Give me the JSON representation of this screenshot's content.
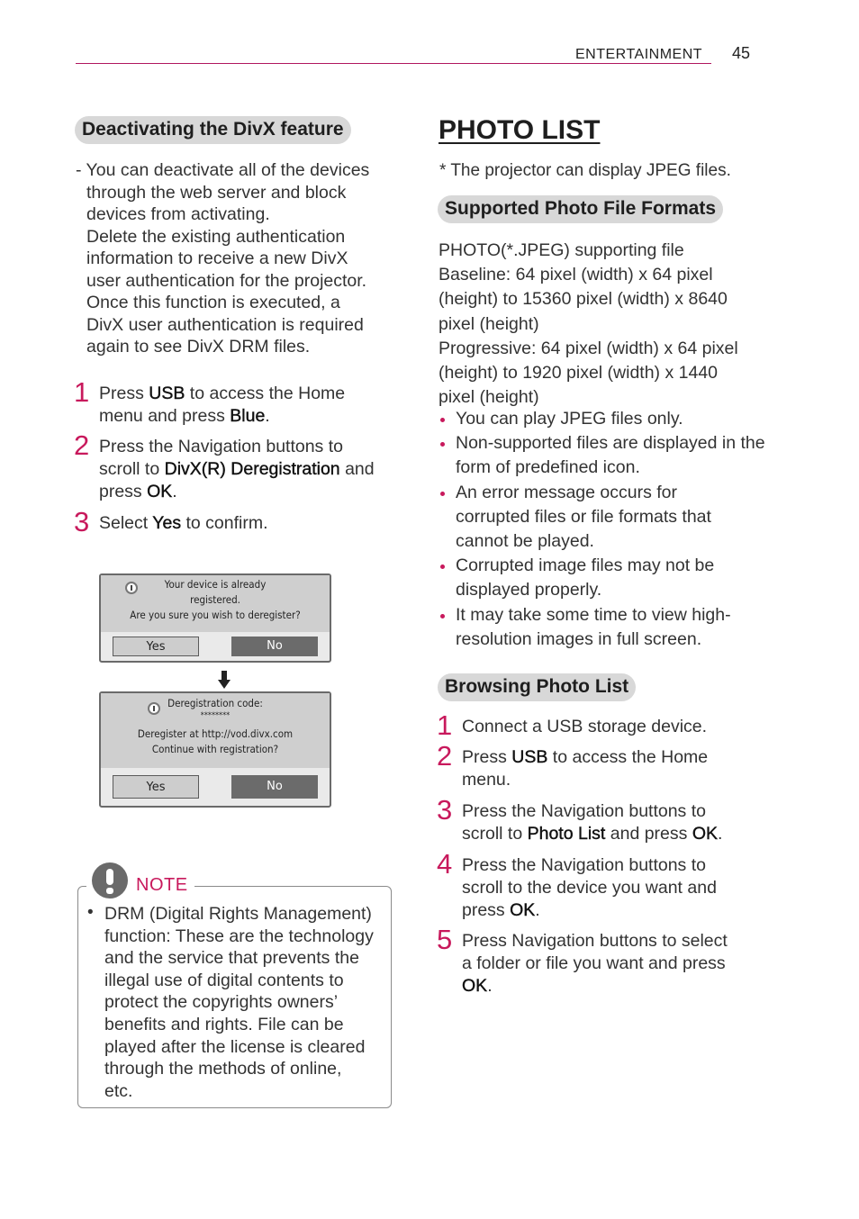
{
  "header": {
    "section": "ENTERTAINMENT",
    "page_number": "45",
    "accent_color": "#b0165e"
  },
  "left": {
    "divx_heading": "Deactivating the DivX feature",
    "divx_intro": [
      "- You can deactivate all of the devices",
      "through the web server and block",
      "devices from activating.",
      "Delete the existing authentication",
      "information to receive a new DivX",
      "user authentication for the projector.",
      "Once this function is executed, a",
      "DivX user authentication is required",
      "again to see DivX DRM files."
    ],
    "steps": [
      {
        "num": "1",
        "parts": [
          "Press ",
          "USB",
          " to access the Home",
          "menu and press ",
          "Blue",
          "."
        ]
      },
      {
        "num": "2",
        "parts": [
          "Press the Navigation buttons to",
          "scroll to ",
          "DivX(R) Deregistration",
          " and",
          "press ",
          "OK",
          "."
        ]
      },
      {
        "num": "3",
        "parts": [
          "Select ",
          "Yes",
          " to confirm."
        ]
      }
    ],
    "dialog1": {
      "icon": "info-icon",
      "lines": [
        "Your device is already",
        "registered.",
        "Are you sure you wish to deregister?"
      ],
      "yes": "Yes",
      "no": "No"
    },
    "arrow_icon": "arrow-down-icon",
    "dialog2": {
      "icon": "info-icon",
      "lines": [
        "Deregistration code:",
        "********",
        "Deregister at http://vod.divx.com",
        "Continue with registration?"
      ],
      "yes": "Yes",
      "no": "No"
    },
    "note": {
      "icon": "exclamation-icon",
      "label": "NOTE",
      "bullet": "•",
      "lines": [
        "DRM (Digital Rights Management)",
        "function: These are the technology",
        "and the service that prevents the",
        "illegal use of digital contents to",
        "protect the copyrights owners’",
        "benefits and rights. File can be",
        "played after the license is cleared",
        "through the methods of online,",
        "etc."
      ]
    }
  },
  "right": {
    "title": "PHOTO LIST",
    "footnote": "*  The projector can display JPEG files.",
    "formats_heading": "Supported Photo File Formats",
    "formats_text": [
      "PHOTO(*.JPEG) supporting file",
      "Baseline: 64 pixel (width) x 64 pixel",
      "(height) to 15360 pixel (width) x 8640",
      "pixel (height)",
      "Progressive: 64 pixel (width) x 64 pixel",
      "(height) to 1920 pixel (width) x 1440",
      "pixel (height)"
    ],
    "bullets": [
      "You can play JPEG files only.",
      "Non-supported files are displayed in the form of predefined icon.",
      "An error message occurs for corrupted files or file formats that cannot be played.",
      "Corrupted image files may not be displayed properly.",
      "It may take some time to view high-resolution images in full screen."
    ],
    "browsing_heading": "Browsing Photo List",
    "browse_steps": [
      {
        "num": "1",
        "parts": [
          "Connect a USB storage device."
        ]
      },
      {
        "num": "2",
        "parts": [
          "Press ",
          "USB",
          " to access the Home",
          "menu."
        ]
      },
      {
        "num": "3",
        "parts": [
          "Press the Navigation buttons to",
          "scroll to ",
          "Photo List",
          " and press ",
          "OK",
          "."
        ]
      },
      {
        "num": "4",
        "parts": [
          "Press the Navigation buttons to",
          "scroll to the device you want and",
          "press ",
          "OK",
          "."
        ]
      },
      {
        "num": "5",
        "parts": [
          "Press Navigation buttons to select",
          "a folder or file you want and press",
          "OK",
          "."
        ]
      }
    ]
  }
}
